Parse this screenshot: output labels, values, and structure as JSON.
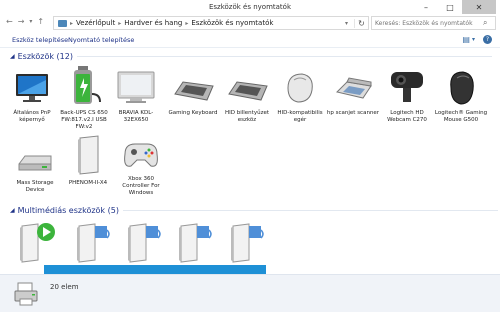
{
  "window": {
    "title": "Eszközök és nyomtatók",
    "minimize": "–",
    "maximize": "□",
    "close": "✕"
  },
  "nav": {
    "back": "←",
    "forward": "→",
    "up": "↑"
  },
  "breadcrumb": [
    "Vezérlőpult",
    "Hardver és hang",
    "Eszközök és nyomtatók"
  ],
  "search": {
    "placeholder": "Keresés: Eszközök és nyomtatók"
  },
  "toolbar": {
    "add_device": "Eszköz telepítése",
    "add_printer": "Nyomtató telepítése"
  },
  "sections": {
    "devices": {
      "label": "Eszközök (12)"
    },
    "multimedia": {
      "label": "Multimédiás eszközök (5)"
    }
  },
  "devices": [
    {
      "label": "Általános PnP képernyő",
      "icon": "monitor-icon"
    },
    {
      "label": "Back-UPS CS 650 FW:817.v2.I USB FW:v2",
      "icon": "battery-icon"
    },
    {
      "label": "BRAVIA KDL-32EX650",
      "icon": "tv-icon"
    },
    {
      "label": "Gaming Keyboard",
      "icon": "keyboard-icon"
    },
    {
      "label": "HID billentyűzet eszköz",
      "icon": "keyboard-icon"
    },
    {
      "label": "HID-kompatibilis egér",
      "icon": "mouse-icon"
    },
    {
      "label": "hp scanjet scanner",
      "icon": "scanner-icon"
    },
    {
      "label": "Logitech HD Webcam C270",
      "icon": "webcam-icon"
    },
    {
      "label": "Logitech® Gaming Mouse G500",
      "icon": "gaming-mouse-icon"
    },
    {
      "label": "Mass Storage Device",
      "icon": "drive-icon"
    },
    {
      "label": "PHENOM-II-X4",
      "icon": "computer-icon"
    },
    {
      "label": "Xbox 360 Controller For Windows",
      "icon": "gamepad-icon"
    }
  ],
  "multimedia": [
    {
      "icon": "media-server-play-icon"
    },
    {
      "icon": "media-server-icon"
    },
    {
      "icon": "media-server-icon"
    },
    {
      "icon": "media-server-icon"
    },
    {
      "icon": "media-server-icon"
    }
  ],
  "details": {
    "count": "20 elem"
  }
}
